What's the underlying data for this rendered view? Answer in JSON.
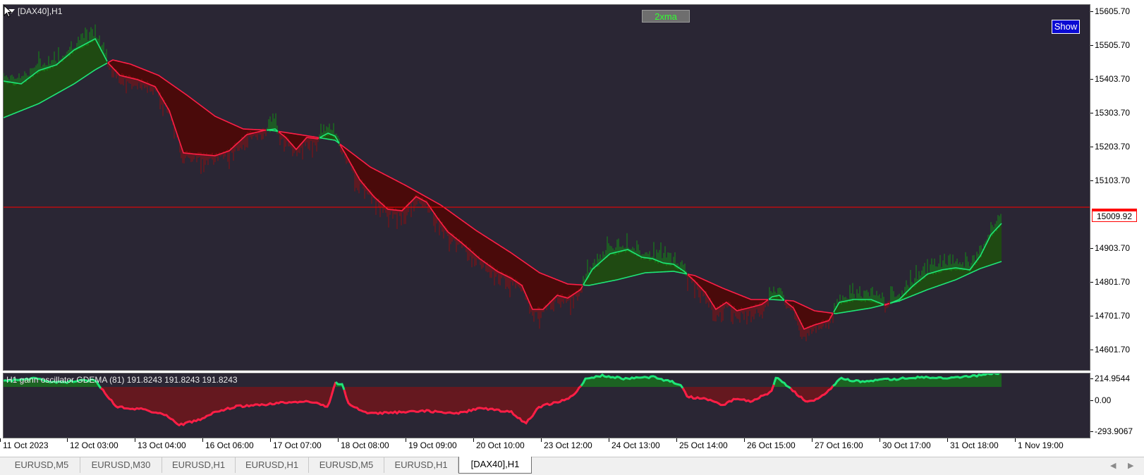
{
  "chart": {
    "symbol_title": "[DAX40],H1",
    "button_2xma": "2xma",
    "button_show": "Show",
    "price_ticks": [
      "15605.70",
      "15505.70",
      "15403.70",
      "15303.70",
      "15203.70",
      "15103.70",
      "14903.70",
      "14801.70",
      "14701.70",
      "14601.70"
    ],
    "current_price": "15009.92",
    "time_ticks": [
      "11 Oct 2023",
      "12 Oct 03:00",
      "13 Oct 04:00",
      "16 Oct 06:00",
      "17 Oct 07:00",
      "18 Oct 08:00",
      "19 Oct 09:00",
      "20 Oct 10:00",
      "23 Oct 12:00",
      "24 Oct 13:00",
      "25 Oct 14:00",
      "26 Oct 15:00",
      "27 Oct 16:00",
      "30 Oct 17:00",
      "31 Oct 18:00",
      "1 Nov 19:00"
    ],
    "colors": {
      "background": "#2a2634",
      "up": "#1ee678",
      "up_fill": "#1f4a12",
      "down": "#ff1e46",
      "down_fill": "#4a0a0a",
      "hist_up": "#0fa00f",
      "hist_down": "#a00a0a",
      "current_price_line": "#ff0000",
      "button_2xma_text": "#32ff32",
      "button_show_bg": "#0a0ad2"
    }
  },
  "oscillator": {
    "label": "H1 gann oscillator GDEMA (81)  191.8243 191.8243 191.8243",
    "ticks": [
      "214.9544",
      "0.00",
      "-293.9067"
    ]
  },
  "tabs": [
    {
      "label": "EURUSD,M5",
      "active": false
    },
    {
      "label": "EURUSD,M30",
      "active": false
    },
    {
      "label": "EURUSD,H1",
      "active": false
    },
    {
      "label": "EURUSD,H1",
      "active": false
    },
    {
      "label": "EURUSD,M5",
      "active": false
    },
    {
      "label": "EURUSD,H1",
      "active": false
    },
    {
      "label": "[DAX40],H1",
      "active": true
    }
  ],
  "icons": {
    "collapse": "triangle-down-icon",
    "cursor": "mouse-pointer-icon",
    "scroll_left": "◀",
    "scroll_right": "▶"
  }
}
